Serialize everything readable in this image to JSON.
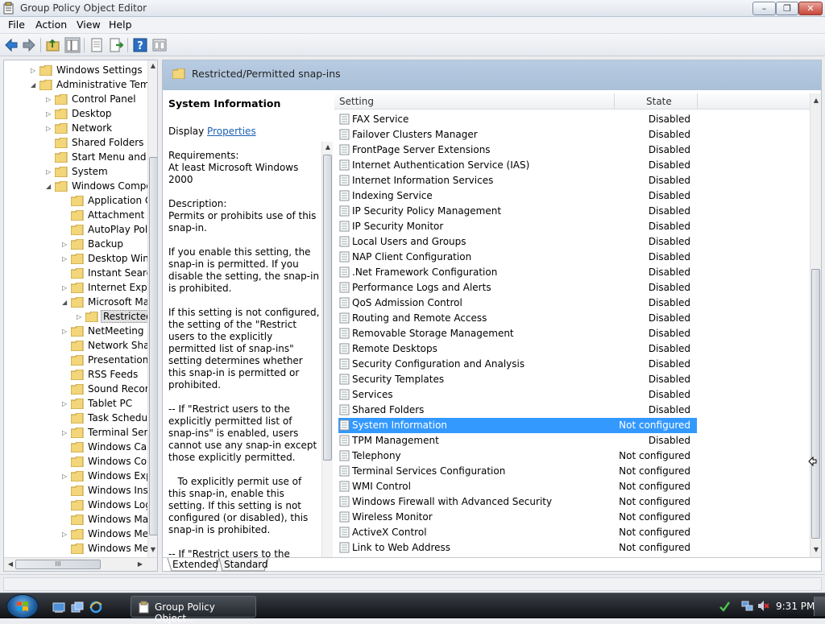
{
  "window": {
    "title": "Group Policy Object Editor"
  },
  "menu": {
    "file": "File",
    "action": "Action",
    "view": "View",
    "help": "Help"
  },
  "tree": {
    "items": [
      {
        "label": "Windows Settings",
        "toggle": "▷",
        "level": 2
      },
      {
        "label": "Administrative Temp",
        "toggle": "◢",
        "level": 2
      },
      {
        "label": "Control Panel",
        "toggle": "▷",
        "level": 3
      },
      {
        "label": "Desktop",
        "toggle": "▷",
        "level": 3
      },
      {
        "label": "Network",
        "toggle": "▷",
        "level": 3
      },
      {
        "label": "Shared Folders",
        "toggle": "",
        "level": 3
      },
      {
        "label": "Start Menu and T",
        "toggle": "",
        "level": 3
      },
      {
        "label": "System",
        "toggle": "▷",
        "level": 3
      },
      {
        "label": "Windows Compo",
        "toggle": "◢",
        "level": 3
      },
      {
        "label": "Application C",
        "toggle": "",
        "level": 4
      },
      {
        "label": "Attachment M",
        "toggle": "",
        "level": 4
      },
      {
        "label": "AutoPlay Polic",
        "toggle": "",
        "level": 4
      },
      {
        "label": "Backup",
        "toggle": "▷",
        "level": 4
      },
      {
        "label": "Desktop Wind",
        "toggle": "▷",
        "level": 4
      },
      {
        "label": "Instant Search",
        "toggle": "",
        "level": 4
      },
      {
        "label": "Internet Explo",
        "toggle": "▷",
        "level": 4
      },
      {
        "label": "Microsoft Ma",
        "toggle": "◢",
        "level": 4
      },
      {
        "label": "Restricted/",
        "toggle": "▷",
        "level": 5,
        "selected": true
      },
      {
        "label": "NetMeeting",
        "toggle": "▷",
        "level": 4
      },
      {
        "label": "Network Shari",
        "toggle": "",
        "level": 4
      },
      {
        "label": "Presentation S",
        "toggle": "",
        "level": 4
      },
      {
        "label": "RSS Feeds",
        "toggle": "",
        "level": 4
      },
      {
        "label": "Sound Record",
        "toggle": "",
        "level": 4
      },
      {
        "label": "Tablet PC",
        "toggle": "▷",
        "level": 4
      },
      {
        "label": "Task Schedule",
        "toggle": "",
        "level": 4
      },
      {
        "label": "Terminal Serv",
        "toggle": "▷",
        "level": 4
      },
      {
        "label": "Windows Cale",
        "toggle": "",
        "level": 4
      },
      {
        "label": "Windows Colo",
        "toggle": "",
        "level": 4
      },
      {
        "label": "Windows Expl",
        "toggle": "▷",
        "level": 4
      },
      {
        "label": "Windows Insta",
        "toggle": "",
        "level": 4
      },
      {
        "label": "Windows Log",
        "toggle": "",
        "level": 4
      },
      {
        "label": "Windows Mai",
        "toggle": "",
        "level": 4
      },
      {
        "label": "Windows Mec",
        "toggle": "▷",
        "level": 4
      },
      {
        "label": "Windows Mes",
        "toggle": "",
        "level": 4
      }
    ],
    "hscroll_grip": "III"
  },
  "pane": {
    "header": "Restricted/Permitted snap-ins",
    "description": {
      "title": "System Information",
      "display_prefix": "Display ",
      "display_link": "Properties",
      "body": "\n\nRequirements:\nAt least Microsoft Windows 2000\n\nDescription:\nPermits or prohibits use of this snap-in.\n\nIf you enable this setting, the snap-in is permitted. If you disable the setting, the snap-in is prohibited.\n\nIf this setting is not configured, the setting of the \"Restrict users to the explicitly permitted list of snap-ins\" setting determines whether this snap-in is permitted or prohibited.\n\n-- If \"Restrict users to the explicitly permitted list of snap-ins\" is enabled, users cannot use any snap-in except those explicitly permitted.\n\n   To explicitly permit use of this snap-in, enable this setting. If this setting is not configured (or disabled), this snap-in is prohibited.\n\n-- If \"Restrict users to the explicitly permitted list of snap-ins\" is disabled or not configured, users can use any snap-in except"
    },
    "columns": {
      "setting": "Setting",
      "state": "State"
    },
    "rows": [
      {
        "setting": "FAX Service",
        "state": "Disabled"
      },
      {
        "setting": "Failover Clusters Manager",
        "state": "Disabled"
      },
      {
        "setting": "FrontPage Server Extensions",
        "state": "Disabled"
      },
      {
        "setting": "Internet Authentication Service (IAS)",
        "state": "Disabled"
      },
      {
        "setting": "Internet Information Services",
        "state": "Disabled"
      },
      {
        "setting": "Indexing Service",
        "state": "Disabled"
      },
      {
        "setting": "IP Security Policy Management",
        "state": "Disabled"
      },
      {
        "setting": "IP Security Monitor",
        "state": "Disabled"
      },
      {
        "setting": "Local Users and Groups",
        "state": "Disabled"
      },
      {
        "setting": "NAP Client Configuration",
        "state": "Disabled"
      },
      {
        "setting": ".Net Framework Configuration",
        "state": "Disabled"
      },
      {
        "setting": "Performance Logs and Alerts",
        "state": "Disabled"
      },
      {
        "setting": "QoS Admission Control",
        "state": "Disabled"
      },
      {
        "setting": "Routing and Remote Access",
        "state": "Disabled"
      },
      {
        "setting": "Removable Storage Management",
        "state": "Disabled"
      },
      {
        "setting": "Remote Desktops",
        "state": "Disabled"
      },
      {
        "setting": "Security Configuration and Analysis",
        "state": "Disabled"
      },
      {
        "setting": "Security Templates",
        "state": "Disabled"
      },
      {
        "setting": "Services",
        "state": "Disabled"
      },
      {
        "setting": "Shared Folders",
        "state": "Disabled"
      },
      {
        "setting": "System Information",
        "state": "Not configured",
        "selected": true
      },
      {
        "setting": "TPM Management",
        "state": "Disabled"
      },
      {
        "setting": "Telephony",
        "state": "Not configured"
      },
      {
        "setting": "Terminal Services Configuration",
        "state": "Not configured"
      },
      {
        "setting": "WMI Control",
        "state": "Not configured"
      },
      {
        "setting": "Windows Firewall with Advanced Security",
        "state": "Not configured"
      },
      {
        "setting": "Wireless Monitor",
        "state": "Not configured"
      },
      {
        "setting": "ActiveX Control",
        "state": "Not configured"
      },
      {
        "setting": "Link to Web Address",
        "state": "Not configured"
      }
    ],
    "tabs": {
      "extended": "Extended",
      "standard": "Standard"
    }
  },
  "taskbar": {
    "task_label": "Group Policy Object...",
    "clock": "9:31 PM"
  },
  "colors": {
    "selection": "#3399ff",
    "header": "#b8cce2",
    "link": "#1a5fb4"
  },
  "icons": {
    "minimize": "–",
    "maximize": "❐",
    "close": "✕"
  }
}
